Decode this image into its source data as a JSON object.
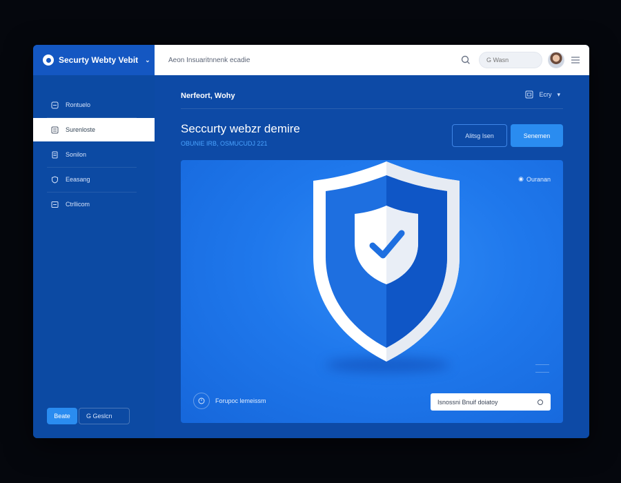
{
  "brand": {
    "title": "Securty Webty Vebit"
  },
  "header": {
    "path": "Aeon Insuaritnnenk ecadie",
    "search_placeholder": "G Wasn"
  },
  "sidebar": {
    "items": [
      {
        "label": "Rontuelo",
        "icon": "dashboard-icon"
      },
      {
        "label": "Surenloste",
        "icon": "list-icon"
      },
      {
        "label": "Sonilon",
        "icon": "document-icon"
      },
      {
        "label": "Eeasang",
        "icon": "shield-outline-icon"
      },
      {
        "label": "Ctrllicom",
        "icon": "report-icon"
      }
    ],
    "primary_button": "Beate",
    "secondary_button": "G Geslcn"
  },
  "main": {
    "breadcrumb": "Nerfeort, Wohy",
    "top_right": "Ecry",
    "title": "Seccurty webzr demire",
    "subtitle": "OBUNIE IRB, OSMUCUDJ 221",
    "outline_button": "Alitsg Isen",
    "solid_button": "Senemen",
    "hero": {
      "label": "Ouranan",
      "bottom_text": "Forupoc lemeissm",
      "input_value": "Isnossni Bnuif doiatoy"
    }
  },
  "colors": {
    "accent": "#2a8cf0",
    "sidebar": "#0c4aa3",
    "hero": "#1f78ec"
  }
}
